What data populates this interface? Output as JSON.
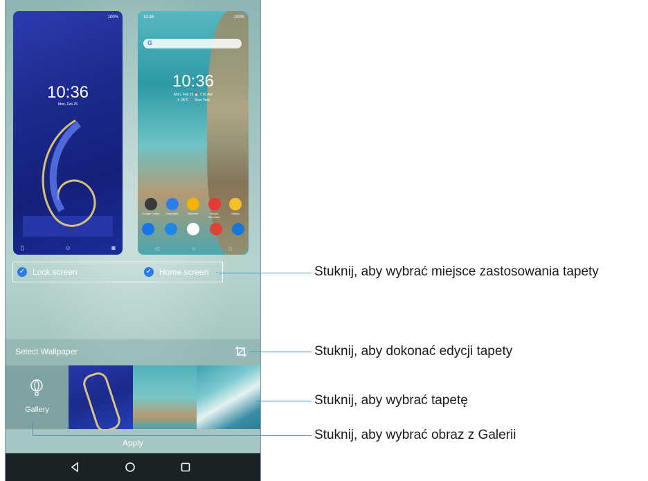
{
  "lock_preview": {
    "clock": "10:36",
    "date": "Mon, Feb 25",
    "status_right": "100%"
  },
  "home_preview": {
    "status_left": "10:36",
    "status_right": "100%",
    "search_logo": "G",
    "clock": "10:36",
    "date": "Mon, Feb 25  ⏰ 7:30 AM",
    "weather": "☀ 25°C  📍 New York",
    "apps": [
      {
        "label": "Google Folder",
        "color": "#3a3a3a"
      },
      {
        "label": "Calculator",
        "color": "#2b7de9"
      },
      {
        "label": "Weather",
        "color": "#f4b400"
      },
      {
        "label": "Sound Recorder",
        "color": "#e53935"
      },
      {
        "label": "Gallery",
        "color": "#f6c026"
      }
    ],
    "dock": [
      {
        "icon": "phone-icon",
        "color": "#1a73e8"
      },
      {
        "icon": "messages-icon",
        "color": "#1e88e5"
      },
      {
        "icon": "play-store-icon",
        "color": "#ffffff"
      },
      {
        "icon": "chrome-icon",
        "color": "#db4437"
      },
      {
        "icon": "camera-icon",
        "color": "#1976d2"
      }
    ]
  },
  "apply_to": {
    "lock_label": "Lock screen",
    "home_label": "Home screen",
    "check_color": "#2c7be5"
  },
  "select_bar": {
    "title": "Select Wallpaper",
    "edit_icon": "crop-icon"
  },
  "thumbnails": {
    "gallery_label": "Gallery",
    "gallery_icon": "balloon-icon"
  },
  "apply_button": {
    "label": "Apply"
  },
  "navbar": {
    "back": "back-icon",
    "home": "home-icon",
    "recent": "recent-apps-icon"
  },
  "callouts": {
    "apply_location": "Stuknij, aby wybrać miejsce zastosowania tapety",
    "edit": "Stuknij, aby dokonać edycji tapety",
    "choose": "Stuknij, aby wybrać tapetę",
    "gallery": "Stuknij, aby wybrać obraz z Galerii"
  }
}
